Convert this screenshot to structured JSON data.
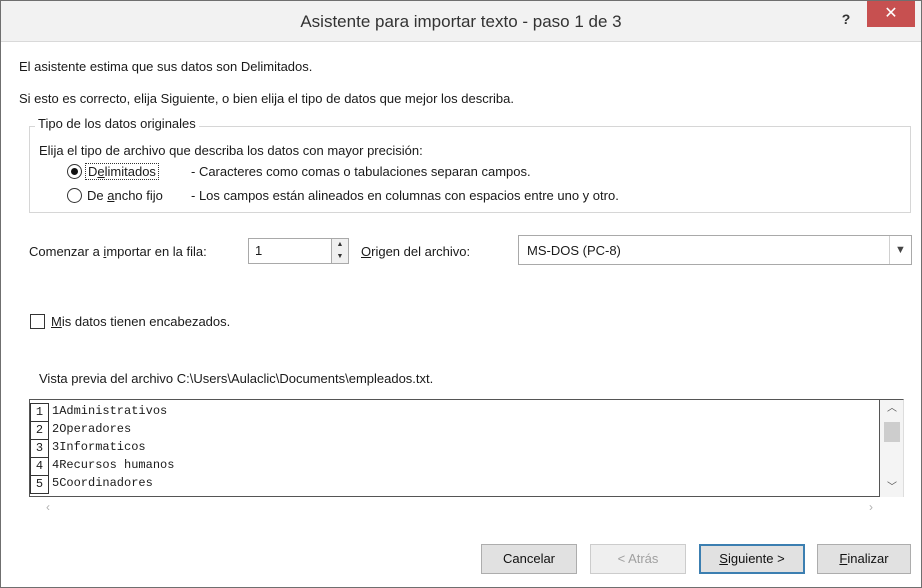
{
  "window": {
    "title": "Asistente para importar texto - paso 1 de 3",
    "help_label": "?",
    "close_label": "✕"
  },
  "intro": {
    "line1": "El asistente estima que sus datos son Delimitados.",
    "line2": "Si esto es correcto, elija Siguiente, o bien elija el tipo de datos que mejor los describa."
  },
  "data_type": {
    "legend": "Tipo de los datos originales",
    "prompt": "Elija el tipo de archivo que describa los datos con mayor precisión:",
    "options": [
      {
        "label_pre": "D",
        "label_u": "e",
        "label_post": "limitados",
        "description": "- Caracteres como comas o tabulaciones separan campos.",
        "selected": true
      },
      {
        "label_pre": "De ",
        "label_u": "a",
        "label_post": "ncho fijo",
        "description": "- Los campos están alineados en columnas con espacios entre uno y otro.",
        "selected": false
      }
    ]
  },
  "start_row": {
    "label_pre": "Comenzar a ",
    "label_u": "i",
    "label_post": "mportar en la fila:",
    "value": "1"
  },
  "origin": {
    "label_u": "O",
    "label_post": "rigen del archivo:",
    "value": "MS-DOS (PC-8)"
  },
  "headers_checkbox": {
    "label_u": "M",
    "label_post": "is datos tienen encabezados.",
    "checked": false
  },
  "preview": {
    "label": "Vista previa del archivo C:\\Users\\Aulaclic\\Documents\\empleados.txt.",
    "rows": [
      {
        "num": "1",
        "text": "1Administrativos"
      },
      {
        "num": "2",
        "text": "2Operadores"
      },
      {
        "num": "3",
        "text": "3Informaticos"
      },
      {
        "num": "4",
        "text": "4Recursos humanos"
      },
      {
        "num": "5",
        "text": "5Coordinadores"
      }
    ]
  },
  "buttons": {
    "cancel": "Cancelar",
    "back": "< Atrás",
    "next_u": "S",
    "next_post": "iguiente >",
    "finish_u": "F",
    "finish_post": "inalizar"
  }
}
